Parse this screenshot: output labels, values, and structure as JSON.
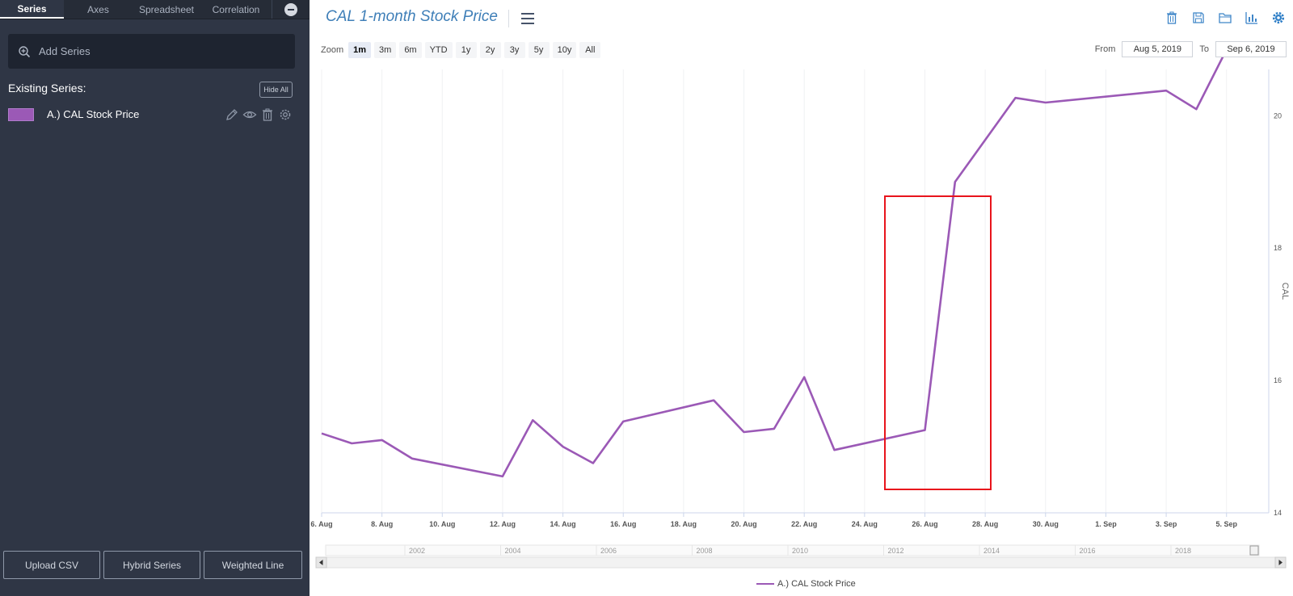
{
  "sidebar": {
    "tabs": [
      {
        "label": "Series"
      },
      {
        "label": "Axes"
      },
      {
        "label": "Spreadsheet"
      },
      {
        "label": "Correlation"
      }
    ],
    "add_series_placeholder": "Add Series",
    "existing_title": "Existing Series:",
    "hide_all_label": "Hide All",
    "series": [
      {
        "name": "A.) CAL Stock Price",
        "color": "#9b59b6"
      }
    ],
    "bottom_buttons": {
      "upload_csv": "Upload CSV",
      "hybrid_series": "Hybrid Series",
      "weighted_line": "Weighted Line"
    }
  },
  "header": {
    "title": "CAL 1-month Stock Price",
    "toolbar_icons": [
      "trash-icon",
      "save-icon",
      "folder-icon",
      "bar-chart-icon",
      "gear-icon"
    ]
  },
  "zoom": {
    "label": "Zoom",
    "options": [
      "1m",
      "3m",
      "6m",
      "YTD",
      "1y",
      "2y",
      "3y",
      "5y",
      "10y",
      "All"
    ],
    "selected": "1m"
  },
  "range": {
    "from_label": "From",
    "from_value": "Aug 5, 2019",
    "to_label": "To",
    "to_value": "Sep 6, 2019"
  },
  "legend": {
    "label": "A.) CAL Stock Price"
  },
  "colors": {
    "series": "#9b59b6",
    "highlight": "#e8141c",
    "accent": "#3f7fb8",
    "sidebar": "#2f3645"
  },
  "chart_data": {
    "type": "line",
    "ylabel": "CAL",
    "ylim": [
      14,
      20.7
    ],
    "yticks": [
      14,
      16,
      18,
      20
    ],
    "x_tick_labels": [
      "6. Aug",
      "8. Aug",
      "10. Aug",
      "12. Aug",
      "14. Aug",
      "16. Aug",
      "18. Aug",
      "20. Aug",
      "22. Aug",
      "24. Aug",
      "26. Aug",
      "28. Aug",
      "30. Aug",
      "1. Sep",
      "3. Sep",
      "5. Sep"
    ],
    "x_tick_days": [
      1,
      3,
      5,
      7,
      9,
      11,
      13,
      15,
      17,
      19,
      21,
      23,
      25,
      27,
      29,
      31
    ],
    "x_range_days": [
      1,
      32.4
    ],
    "series": [
      {
        "name": "A.) CAL Stock Price",
        "x": [
          "2019-08-06",
          "2019-08-07",
          "2019-08-08",
          "2019-08-09",
          "2019-08-12",
          "2019-08-13",
          "2019-08-14",
          "2019-08-15",
          "2019-08-16",
          "2019-08-19",
          "2019-08-20",
          "2019-08-21",
          "2019-08-22",
          "2019-08-23",
          "2019-08-26",
          "2019-08-27",
          "2019-08-29",
          "2019-08-30",
          "2019-09-03",
          "2019-09-04",
          "2019-09-05"
        ],
        "x_days": [
          1,
          2,
          3,
          4,
          7,
          8,
          9,
          10,
          11,
          14,
          15,
          16,
          17,
          18,
          21,
          22,
          24,
          25,
          29,
          30,
          31
        ],
        "values": [
          15.2,
          15.05,
          15.1,
          14.82,
          14.55,
          15.4,
          15.0,
          14.75,
          15.38,
          15.7,
          15.22,
          15.27,
          16.05,
          14.95,
          15.25,
          19.0,
          20.27,
          20.2,
          20.38,
          20.1,
          21.0
        ]
      }
    ],
    "navigator": {
      "labels": [
        "2002",
        "2004",
        "2006",
        "2008",
        "2010",
        "2012",
        "2014",
        "2016",
        "2018"
      ]
    }
  }
}
